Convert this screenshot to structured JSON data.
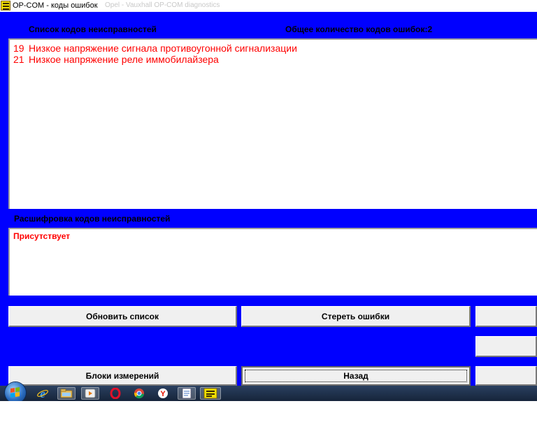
{
  "window": {
    "title": "OP-COM - коды ошибок",
    "background_title": "Opel - Vauxhall OP-COM diagnostics"
  },
  "labels": {
    "dtc_list": "Список кодов неисправностей",
    "dtc_count": "Общее количество кодов ошибок:2",
    "decode": "Расшифровка кодов неисправностей"
  },
  "dtc_list": [
    {
      "code": "19",
      "description": "Низкое напряжение сигнала противоугонной сигнализации"
    },
    {
      "code": "21",
      "description": "Низкое напряжение реле иммобилайзера"
    }
  ],
  "decode": {
    "status": "Присутствует"
  },
  "buttons": {
    "refresh": "Обновить список",
    "clear": "Стереть ошибки",
    "measurements": "Блоки измерений",
    "back": "Назад",
    "right1": "",
    "right2": "",
    "right3": ""
  },
  "taskbar": {
    "icons": [
      "windows-start-icon",
      "internet-explorer-icon",
      "file-explorer-icon",
      "media-player-icon",
      "opera-icon",
      "chrome-icon",
      "yandex-browser-icon",
      "notepad-icon",
      "opcom-icon"
    ]
  },
  "colors": {
    "client_bg": "#0000ff",
    "error_text": "#ff0000",
    "button_face": "#f0f0f0",
    "taskbar": "#1e3250"
  }
}
